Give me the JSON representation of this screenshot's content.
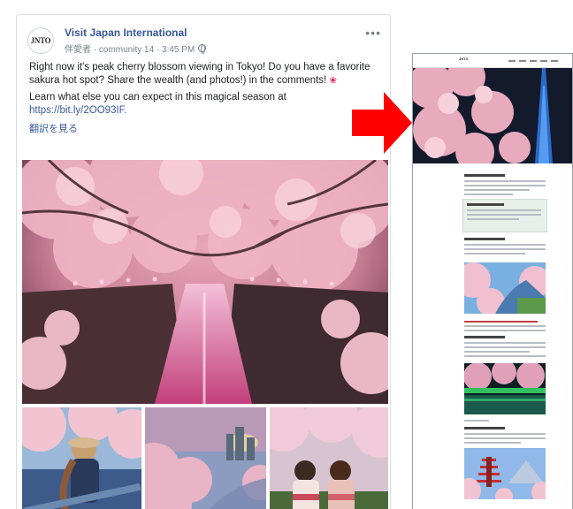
{
  "post": {
    "avatar_text": "JNTO",
    "page_name": "Visit Japan International",
    "meta": "伴愛者 · community 14 · 3:45 PM",
    "more_label": "•••",
    "text_line1": "Right now it's peak cherry blossom viewing in Tokyo! Do you have a favorite sakura hot spot? Share the wealth (and photos!) in the comments! ",
    "text_line2": "Learn what else you can expect in this magical season at",
    "link": "https://bit.ly/2OO93IF.",
    "see_translation": "翻訳を見る",
    "photos": [
      "hero-meguro-river-night",
      "boat-blossoms",
      "moat-blossoms-skyline",
      "kimono-blossoms"
    ]
  },
  "arrow": {
    "color": "#ff0000"
  },
  "article": {
    "logo_text": "JNTO",
    "images": [
      "hero-skytree-blossoms",
      "moat-blossoms",
      "illuminated-river",
      "pagoda-fuji"
    ]
  },
  "colors": {
    "fb_link": "#385898",
    "arrow": "#ff0000",
    "article_note_bg": "#e6efe9"
  }
}
